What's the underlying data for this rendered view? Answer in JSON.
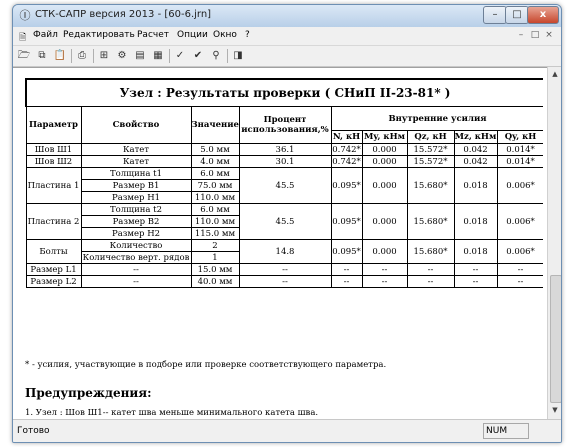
{
  "window": {
    "title": "СТК-САПР версия 2013 - [60-6.jrn]",
    "minimize_label": "–",
    "maximize_label": "□",
    "close_label": "x"
  },
  "menu": {
    "items": [
      "Файл",
      "Редактировать",
      "Расчет",
      "Опции",
      "Окно",
      "?"
    ],
    "mdi_controls": [
      "–",
      "□",
      "×"
    ]
  },
  "toolbar": {
    "icons": [
      "open-icon",
      "copy-icon",
      "paste-icon",
      "print-icon",
      "calc-icon",
      "settings-icon",
      "chart-icon",
      "check-icon",
      "verify-icon",
      "zoom-icon",
      "help-icon"
    ]
  },
  "report": {
    "title": "Узел : Результаты проверки ( СНиП II-23-81* )",
    "headers": {
      "param": "Параметр",
      "prop": "Свойство",
      "value": "Значение",
      "percent": "Процент использования,%",
      "forces": "Внутренние усилия",
      "n": "N, кН",
      "my": "My, кНм",
      "qz": "Qz, кН",
      "mz": "Mz, кНм",
      "qy": "Qy, кН"
    },
    "rows": {
      "w1": {
        "param": "Шов Ш1",
        "prop": "Катет",
        "value": "5.0 мм",
        "percent": "36.1",
        "n": "0.742*",
        "my": "0.000",
        "qz": "15.572*",
        "mz": "0.042",
        "qy": "0.014*"
      },
      "w2": {
        "param": "Шов Ш2",
        "prop": "Катет",
        "value": "4.0 мм",
        "percent": "30.1",
        "n": "0.742*",
        "my": "0.000",
        "qz": "15.572*",
        "mz": "0.042",
        "qy": "0.014*"
      },
      "p1": {
        "param": "Пластина 1",
        "props": [
          "Толщина t1",
          "Размер B1",
          "Размер H1"
        ],
        "values": [
          "6.0 мм",
          "75.0 мм",
          "110.0 мм"
        ],
        "percent": "45.5",
        "n": "0.095*",
        "my": "0.000",
        "qz": "15.680*",
        "mz": "0.018",
        "qy": "0.006*"
      },
      "p2": {
        "param": "Пластина 2",
        "props": [
          "Толщина t2",
          "Размер B2",
          "Размер H2"
        ],
        "values": [
          "6.0 мм",
          "110.0 мм",
          "115.0 мм"
        ],
        "percent": "45.5",
        "n": "0.095*",
        "my": "0.000",
        "qz": "15.680*",
        "mz": "0.018",
        "qy": "0.006*"
      },
      "bolts": {
        "param": "Болты",
        "props": [
          "Количество",
          "Количество верт. рядов"
        ],
        "values": [
          "2",
          "1"
        ],
        "percent": "14.8",
        "n": "0.095*",
        "my": "0.000",
        "qz": "15.680*",
        "mz": "0.018",
        "qy": "0.006*"
      },
      "l1": {
        "param": "Размер L1",
        "prop": "--",
        "value": "15.0 мм",
        "percent": "--",
        "n": "--",
        "my": "--",
        "qz": "--",
        "mz": "--",
        "qy": "--"
      },
      "l2": {
        "param": "Размер L2",
        "prop": "--",
        "value": "40.0 мм",
        "percent": "--",
        "n": "--",
        "my": "--",
        "qz": "--",
        "mz": "--",
        "qy": "--"
      }
    },
    "footnote": "* - усилия, участвующие в подборе или проверке соответствующего параметра.",
    "warnings_title": "Предупреждения:",
    "warnings": [
      "1. Узел : Шов Ш1-- катет шва меньше минимального катета шва."
    ]
  },
  "statusbar": {
    "text": "Готово",
    "num": "NUM"
  }
}
